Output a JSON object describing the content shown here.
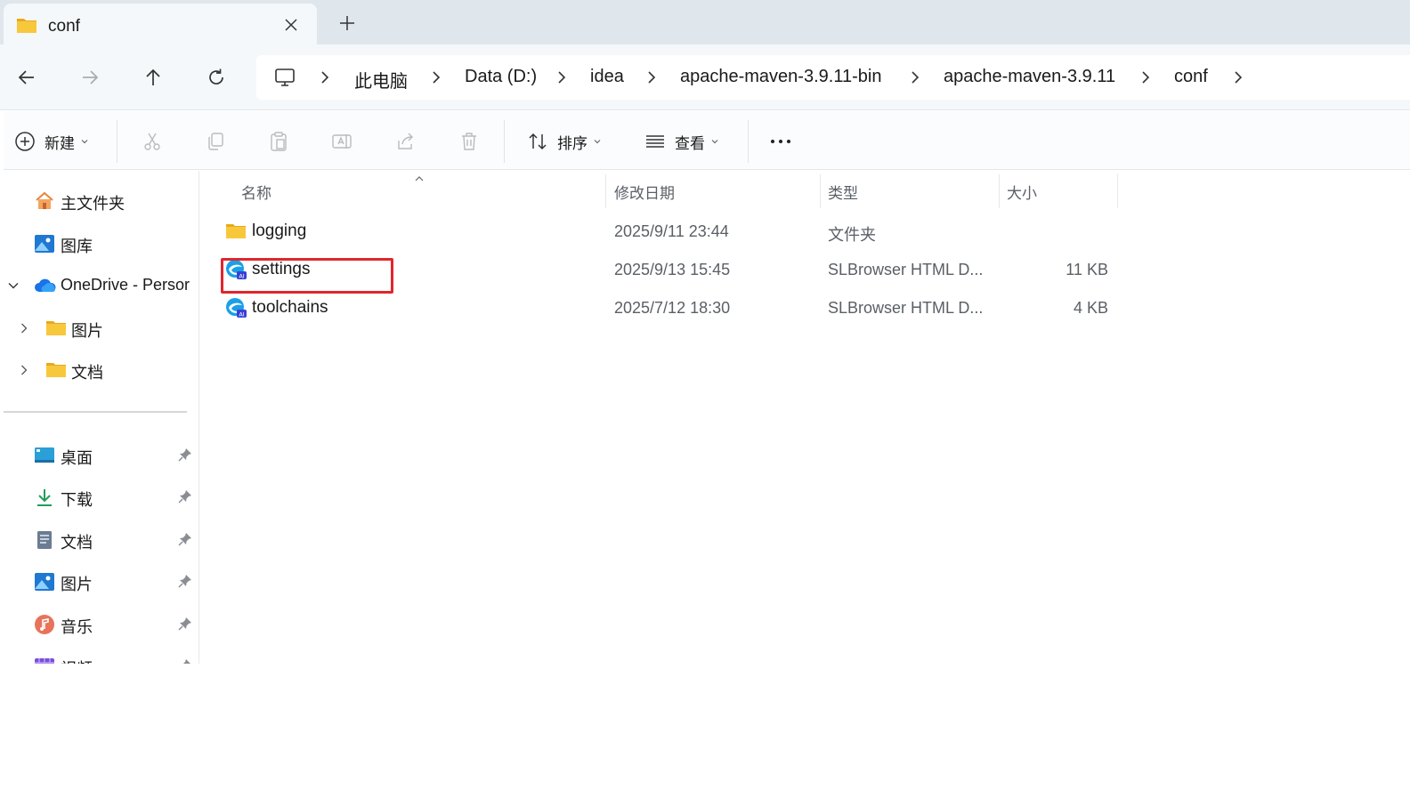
{
  "tab": {
    "title": "conf"
  },
  "breadcrumb": [
    "此电脑",
    "Data (D:)",
    "idea",
    "apache-maven-3.9.11-bin",
    "apache-maven-3.9.11",
    "conf"
  ],
  "toolbar": {
    "new_label": "新建",
    "sort_label": "排序",
    "view_label": "查看"
  },
  "sidebar": {
    "top_items": [
      {
        "label": "主文件夹",
        "icon": "home-icon"
      },
      {
        "label": "图库",
        "icon": "gallery-icon"
      },
      {
        "label": "OneDrive - Persor",
        "icon": "onedrive-icon"
      },
      {
        "label": "图片",
        "icon": "folder-icon"
      },
      {
        "label": "文档",
        "icon": "folder-icon"
      }
    ],
    "quick_access": [
      {
        "label": "桌面",
        "icon": "desktop-icon"
      },
      {
        "label": "下载",
        "icon": "download-icon"
      },
      {
        "label": "文档",
        "icon": "document-icon"
      },
      {
        "label": "图片",
        "icon": "pictures-icon"
      },
      {
        "label": "音乐",
        "icon": "music-icon"
      },
      {
        "label": "视频",
        "icon": "video-icon"
      }
    ]
  },
  "columns": {
    "name": "名称",
    "modified": "修改日期",
    "type": "类型",
    "size": "大小"
  },
  "files": [
    {
      "name": "logging",
      "modified": "2025/9/11 23:44",
      "type": "文件夹",
      "size": "",
      "icon": "folder-icon"
    },
    {
      "name": "settings",
      "modified": "2025/9/13 15:45",
      "type": "SLBrowser HTML D...",
      "size": "11 KB",
      "icon": "slbrowser-html-icon"
    },
    {
      "name": "toolchains",
      "modified": "2025/7/12 18:30",
      "type": "SLBrowser HTML D...",
      "size": "4 KB",
      "icon": "slbrowser-html-icon"
    }
  ],
  "colors": {
    "highlight": "#e0262b",
    "folder": "#f8c83c",
    "accent": "#0a64c8"
  }
}
